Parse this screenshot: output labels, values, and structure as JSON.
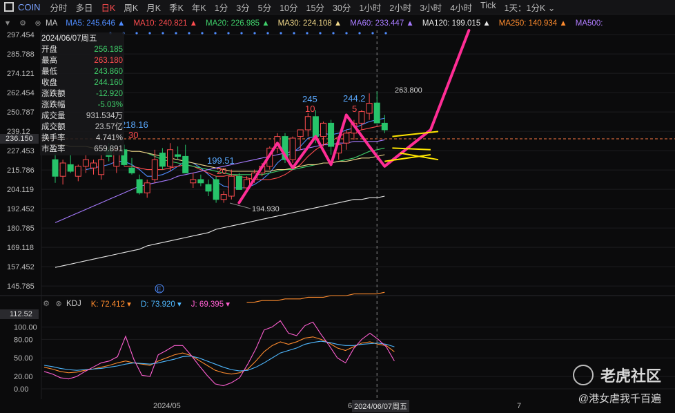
{
  "topbar": {
    "symbol": "COIN",
    "timeframes": [
      "分时",
      "多日",
      "日K",
      "周K",
      "月K",
      "季K",
      "年K",
      "1分",
      "3分",
      "5分",
      "10分",
      "15分",
      "30分",
      "1小时",
      "2小时",
      "3小时",
      "4小时",
      "Tick"
    ],
    "active": "日K",
    "dropdown": "1天：1分K"
  },
  "ma_bar": {
    "indicator": "MA",
    "items": [
      {
        "label": "MA5: 245.646",
        "color": "#4f8cff"
      },
      {
        "label": "MA10: 240.821",
        "color": "#ff4d4f"
      },
      {
        "label": "MA20: 226.985",
        "color": "#3fcf6a"
      },
      {
        "label": "MA30: 224.108",
        "color": "#f2d98a"
      },
      {
        "label": "MA60: 233.447",
        "color": "#a77bff"
      },
      {
        "label": "MA120: 199.015",
        "color": "#e6e6e6"
      },
      {
        "label": "MA250: 140.934",
        "color": "#ff8c2e"
      },
      {
        "label": "MA500:",
        "color": "#b07cff"
      }
    ]
  },
  "info_box": {
    "date": "2024/06/07周五",
    "rows": [
      {
        "k": "开盘",
        "v": "256.185",
        "c": "#3fcf6a"
      },
      {
        "k": "最高",
        "v": "263.180",
        "c": "#ff4d4f"
      },
      {
        "k": "最低",
        "v": "243.860",
        "c": "#3fcf6a"
      },
      {
        "k": "收盘",
        "v": "244.160",
        "c": "#3fcf6a"
      },
      {
        "k": "涨跌额",
        "v": "-12.920",
        "c": "#3fcf6a"
      },
      {
        "k": "涨跌幅",
        "v": "-5.03%",
        "c": "#3fcf6a"
      },
      {
        "k": "成交量",
        "v": "931.534万",
        "c": "#cfcfcf"
      },
      {
        "k": "成交额",
        "v": "23.57亿",
        "c": "#cfcfcf"
      },
      {
        "k": "换手率",
        "v": "4.741%",
        "c": "#cfcfcf"
      },
      {
        "k": "市盈率",
        "v": "659.891",
        "c": "#cfcfcf"
      }
    ]
  },
  "price_axis": [
    "297.454",
    "285.788",
    "274.121",
    "262.454",
    "250.787",
    "239.12",
    "227.453",
    "215.786",
    "204.119",
    "192.452",
    "180.785",
    "169.118",
    "157.452",
    "145.785"
  ],
  "current_price": "236.150",
  "kdj_bar": {
    "indicator": "KDJ",
    "items": [
      {
        "label": "K: 72.412",
        "color": "#ff8c2e"
      },
      {
        "label": "D: 73.920",
        "color": "#4fb8ff"
      },
      {
        "label": "J: 69.395",
        "color": "#ff5fd2"
      }
    ]
  },
  "kdj_axis": [
    "100.00",
    "80.00",
    "50.00",
    "20.00",
    "0.00"
  ],
  "kdj_current": "112.52",
  "x_axis": {
    "labels": [
      "2024/05",
      "6",
      "7"
    ],
    "cursor": "2024/06/07周五"
  },
  "annotations": {
    "high_label": "263.800",
    "low_label": "194.930",
    "label_218": "218.16",
    "label_30": "30",
    "label_19951": "199.51",
    "label_20": "20",
    "label_245": "245",
    "label_10": "10",
    "label_2442": "244.2",
    "label_5": "5",
    "event_marker": "E"
  },
  "watermark": {
    "brand": "老虎社区",
    "user": "@港女虐我千百遍"
  },
  "chart_data": {
    "type": "candlestick",
    "title": "",
    "ylim": [
      140,
      300
    ],
    "candles": [
      {
        "o": 222,
        "h": 226,
        "l": 208,
        "c": 212
      },
      {
        "o": 212,
        "h": 222,
        "l": 207,
        "c": 220
      },
      {
        "o": 219,
        "h": 225,
        "l": 214,
        "c": 215
      },
      {
        "o": 212,
        "h": 219,
        "l": 209,
        "c": 218
      },
      {
        "o": 218,
        "h": 225,
        "l": 214,
        "c": 222
      },
      {
        "o": 217,
        "h": 222,
        "l": 213,
        "c": 220
      },
      {
        "o": 213,
        "h": 225,
        "l": 210,
        "c": 222
      },
      {
        "o": 228,
        "h": 232,
        "l": 221,
        "c": 224
      },
      {
        "o": 218,
        "h": 230,
        "l": 214,
        "c": 228
      },
      {
        "o": 228,
        "h": 231,
        "l": 218,
        "c": 219
      },
      {
        "o": 217,
        "h": 223,
        "l": 213,
        "c": 214
      },
      {
        "o": 210,
        "h": 213,
        "l": 201,
        "c": 202
      },
      {
        "o": 202,
        "h": 210,
        "l": 199,
        "c": 208
      },
      {
        "o": 210,
        "h": 228,
        "l": 208,
        "c": 222
      },
      {
        "o": 226,
        "h": 229,
        "l": 216,
        "c": 218
      },
      {
        "o": 218,
        "h": 232,
        "l": 215,
        "c": 228
      },
      {
        "o": 225,
        "h": 230,
        "l": 222,
        "c": 224
      },
      {
        "o": 224,
        "h": 231,
        "l": 216,
        "c": 214
      },
      {
        "o": 208,
        "h": 214,
        "l": 205,
        "c": 210
      },
      {
        "o": 210,
        "h": 213,
        "l": 206,
        "c": 208
      },
      {
        "o": 207,
        "h": 210,
        "l": 200,
        "c": 203
      },
      {
        "o": 210,
        "h": 212,
        "l": 196,
        "c": 198
      },
      {
        "o": 198,
        "h": 203,
        "l": 196,
        "c": 201
      },
      {
        "o": 200,
        "h": 216,
        "l": 198,
        "c": 212
      },
      {
        "o": 212,
        "h": 214,
        "l": 204,
        "c": 204
      },
      {
        "o": 205,
        "h": 212,
        "l": 202,
        "c": 210
      },
      {
        "o": 210,
        "h": 216,
        "l": 208,
        "c": 214
      },
      {
        "o": 214,
        "h": 220,
        "l": 212,
        "c": 218
      },
      {
        "o": 218,
        "h": 230,
        "l": 216,
        "c": 229
      },
      {
        "o": 229,
        "h": 238,
        "l": 226,
        "c": 236
      },
      {
        "o": 236,
        "h": 238,
        "l": 220,
        "c": 222
      },
      {
        "o": 222,
        "h": 236,
        "l": 220,
        "c": 235
      },
      {
        "o": 236,
        "h": 240,
        "l": 228,
        "c": 240
      },
      {
        "o": 240,
        "h": 250,
        "l": 236,
        "c": 248
      },
      {
        "o": 248,
        "h": 252,
        "l": 232,
        "c": 236
      },
      {
        "o": 236,
        "h": 245,
        "l": 230,
        "c": 244
      },
      {
        "o": 244,
        "h": 246,
        "l": 225,
        "c": 230
      },
      {
        "o": 226,
        "h": 234,
        "l": 222,
        "c": 231
      },
      {
        "o": 232,
        "h": 240,
        "l": 228,
        "c": 238
      },
      {
        "o": 238,
        "h": 246,
        "l": 234,
        "c": 244
      },
      {
        "o": 244,
        "h": 252,
        "l": 240,
        "c": 251
      },
      {
        "o": 250,
        "h": 262,
        "l": 246,
        "c": 256
      },
      {
        "o": 256.185,
        "h": 263.18,
        "l": 243.86,
        "c": 244.16
      },
      {
        "o": 244,
        "h": 249,
        "l": 238,
        "c": 240
      }
    ],
    "ma_lines": [
      {
        "name": "MA5",
        "color": "#4f8cff",
        "values": [
          null,
          null,
          null,
          null,
          216,
          217,
          218,
          219,
          221,
          221,
          219,
          216,
          212,
          212,
          213,
          215,
          218,
          221,
          220,
          217,
          213,
          209,
          206,
          205,
          205,
          205,
          207,
          210,
          214,
          220,
          224,
          226,
          230,
          235,
          236,
          238,
          237,
          238,
          240,
          241,
          243,
          245,
          246,
          247
        ]
      },
      {
        "name": "MA10",
        "color": "#ff4d4f",
        "values": [
          null,
          null,
          null,
          null,
          null,
          null,
          null,
          null,
          null,
          218,
          218,
          217,
          216,
          216,
          216,
          217,
          218,
          219,
          218,
          216,
          214,
          212,
          212,
          213,
          212,
          211,
          210,
          210,
          210,
          211,
          213,
          216,
          219,
          224,
          228,
          231,
          233,
          236,
          238,
          239,
          240,
          241,
          242,
          243
        ]
      },
      {
        "name": "MA20",
        "color": "#3fcf6a",
        "values": [
          null,
          null,
          null,
          null,
          null,
          null,
          null,
          null,
          null,
          null,
          null,
          null,
          226,
          224,
          222,
          221,
          220,
          219,
          218,
          217,
          216,
          215,
          214,
          213,
          213,
          213,
          213,
          213,
          214,
          215,
          216,
          216,
          217,
          218,
          219,
          220,
          220,
          221,
          222,
          223,
          225,
          227,
          228,
          229
        ]
      },
      {
        "name": "MA30",
        "color": "#f2d98a",
        "values": [
          231,
          231,
          230,
          230,
          230,
          229,
          229,
          229,
          228,
          228,
          227,
          227,
          226,
          225,
          224,
          223,
          222,
          221,
          220,
          219,
          218,
          217,
          216,
          215,
          215,
          215,
          215,
          215,
          215,
          216,
          216,
          217,
          218,
          219,
          219,
          220,
          220,
          221,
          221,
          222,
          223,
          223,
          224,
          225
        ]
      },
      {
        "name": "MA60",
        "color": "#a77bff",
        "values": [
          184,
          186,
          188,
          190,
          192,
          194,
          196,
          198,
          200,
          202,
          204,
          206,
          207,
          208,
          209,
          210,
          212,
          213,
          214,
          215,
          216,
          217,
          218,
          219,
          220,
          221,
          222,
          223,
          224,
          225,
          226,
          227,
          228,
          229,
          230,
          231,
          231,
          232,
          232,
          233,
          233,
          233,
          233,
          234
        ]
      },
      {
        "name": "MA120",
        "color": "#e6e6e6",
        "values": [
          157,
          158,
          159,
          160,
          161,
          162,
          163,
          164,
          165,
          166,
          167,
          168,
          170,
          171,
          172,
          173,
          174,
          175,
          176,
          177,
          178,
          180,
          181,
          182,
          183,
          184,
          185,
          186,
          187,
          188,
          189,
          190,
          191,
          192,
          193,
          194,
          195,
          196,
          197,
          198,
          198,
          199,
          199,
          200
        ]
      },
      {
        "name": "MA250",
        "color": "#ff8c2e",
        "values": [
          null,
          null,
          null,
          null,
          null,
          null,
          null,
          null,
          null,
          null,
          null,
          null,
          null,
          null,
          null,
          null,
          null,
          null,
          null,
          null,
          null,
          null,
          null,
          null,
          null,
          136,
          136,
          137,
          137,
          137,
          138,
          138,
          138,
          139,
          139,
          139,
          140,
          140,
          140,
          141,
          141,
          141,
          141,
          142
        ]
      }
    ],
    "drawing_pink": [
      [
        24,
        196
      ],
      [
        29,
        232
      ],
      [
        31,
        217
      ],
      [
        34,
        236
      ],
      [
        36,
        219
      ],
      [
        38,
        249
      ],
      [
        41,
        230
      ],
      [
        43,
        218
      ],
      [
        49,
        240
      ],
      [
        54,
        300
      ]
    ],
    "kdj": {
      "ylim": [
        -10,
        115
      ],
      "K": [
        35,
        32,
        28,
        26,
        27,
        30,
        32,
        35,
        38,
        42,
        45,
        42,
        40,
        38,
        45,
        50,
        55,
        58,
        54,
        46,
        38,
        30,
        26,
        24,
        26,
        32,
        45,
        60,
        70,
        76,
        72,
        76,
        82,
        84,
        80,
        74,
        66,
        62,
        68,
        74,
        76,
        72,
        70,
        60
      ],
      "D": [
        38,
        36,
        33,
        31,
        30,
        31,
        32,
        33,
        35,
        37,
        40,
        42,
        41,
        40,
        42,
        45,
        48,
        52,
        53,
        50,
        45,
        40,
        35,
        31,
        29,
        30,
        35,
        42,
        50,
        58,
        62,
        66,
        72,
        75,
        77,
        75,
        72,
        70,
        70,
        72,
        73,
        74,
        72,
        68
      ],
      "J": [
        28,
        24,
        18,
        16,
        20,
        28,
        35,
        42,
        45,
        52,
        85,
        48,
        22,
        20,
        55,
        62,
        70,
        70,
        55,
        38,
        22,
        8,
        5,
        10,
        18,
        40,
        65,
        95,
        100,
        110,
        90,
        86,
        102,
        108,
        88,
        70,
        50,
        42,
        65,
        80,
        90,
        80,
        68,
        45
      ]
    }
  }
}
